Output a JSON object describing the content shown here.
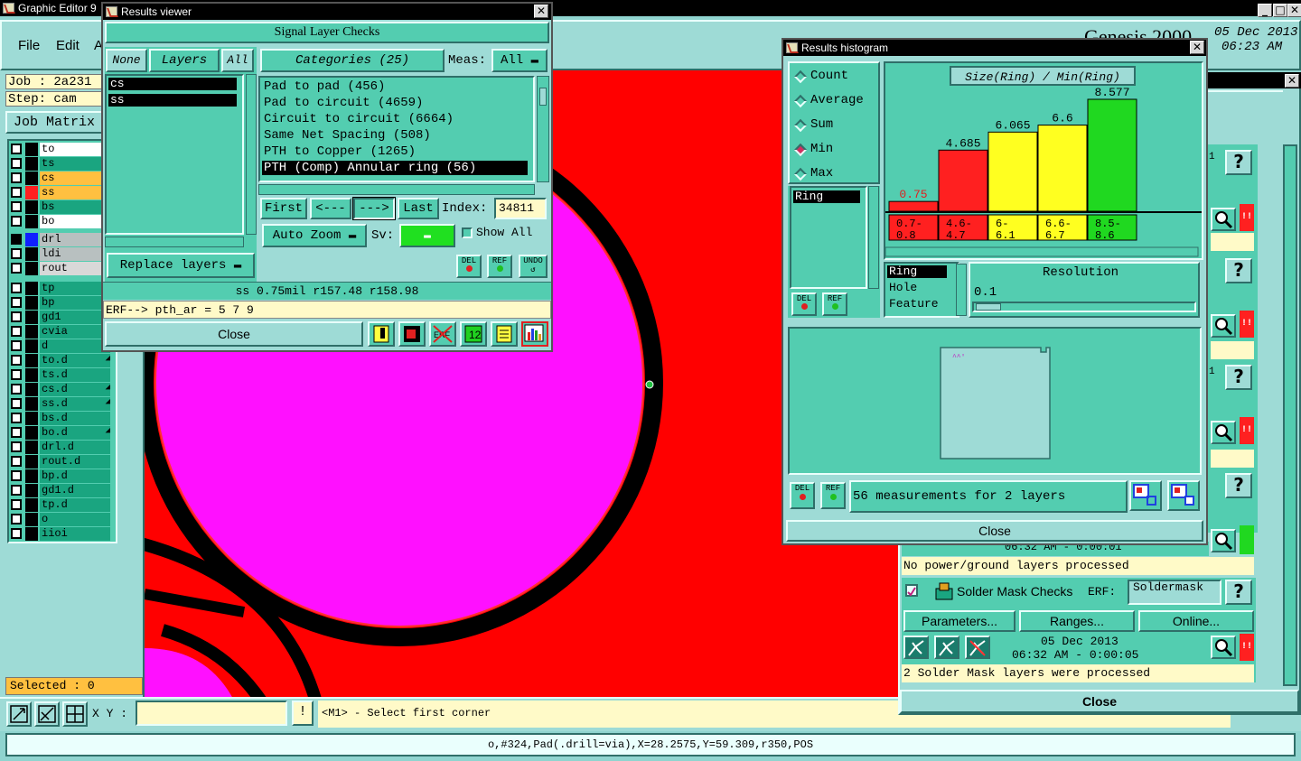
{
  "main_window": {
    "title": "Graphic Editor 9",
    "menu": [
      "File",
      "Edit",
      "A"
    ],
    "job": "Job : 2a231",
    "step": "Step: cam",
    "job_matrix": "Job Matrix",
    "selected": "Selected : 0",
    "xy_label": "X Y :",
    "xy_value": "",
    "prompt": "<M1> - Select first corner",
    "status": "o,#324,Pad(.drill=via),X=28.2575,Y=59.309,r350,POS",
    "genesis": "Genesis 2000",
    "date": "05 Dec 2013",
    "time": "06:23 AM"
  },
  "layers": [
    {
      "name": "to",
      "color": "#ffffff",
      "swatch": "#000000"
    },
    {
      "name": "ts",
      "color": "#1aa580",
      "swatch": "#000000"
    },
    {
      "name": "cs",
      "color": "#ffc040",
      "swatch": "#000000"
    },
    {
      "name": "ss",
      "color": "#ffc040",
      "swatch": "#ff2020"
    },
    {
      "name": "bs",
      "color": "#1aa580",
      "swatch": "#000000"
    },
    {
      "name": "bo",
      "color": "#ffffff",
      "swatch": "#000000"
    },
    {
      "name": "drl",
      "color": "#b8c0c0",
      "swatch": "#1020ff"
    },
    {
      "name": "ldi",
      "color": "#b8c0c0",
      "swatch": "#000000"
    },
    {
      "name": "rout",
      "color": "#d8d8d8",
      "swatch": "#000000"
    },
    {
      "name": "tp",
      "color": "#1aa580",
      "swatch": "#000000"
    },
    {
      "name": "bp",
      "color": "#1aa580",
      "swatch": "#000000"
    },
    {
      "name": "gd1",
      "color": "#1aa580",
      "swatch": "#000000"
    },
    {
      "name": "cvia",
      "color": "#1aa580",
      "swatch": "#000000"
    },
    {
      "name": "d",
      "color": "#1aa580",
      "swatch": "#000000"
    },
    {
      "name": "to.d",
      "color": "#1aa580",
      "swatch": "#000000",
      "mark": true
    },
    {
      "name": "ts.d",
      "color": "#1aa580",
      "swatch": "#000000"
    },
    {
      "name": "cs.d",
      "color": "#1aa580",
      "swatch": "#000000",
      "mark": true
    },
    {
      "name": "ss.d",
      "color": "#1aa580",
      "swatch": "#000000",
      "mark": true
    },
    {
      "name": "bs.d",
      "color": "#1aa580",
      "swatch": "#000000"
    },
    {
      "name": "bo.d",
      "color": "#1aa580",
      "swatch": "#000000",
      "mark": true
    },
    {
      "name": "drl.d",
      "color": "#1aa580",
      "swatch": "#000000"
    },
    {
      "name": "rout.d",
      "color": "#1aa580",
      "swatch": "#000000"
    },
    {
      "name": "bp.d",
      "color": "#1aa580",
      "swatch": "#000000"
    },
    {
      "name": "gd1.d",
      "color": "#1aa580",
      "swatch": "#000000"
    },
    {
      "name": "tp.d",
      "color": "#1aa580",
      "swatch": "#000000"
    },
    {
      "name": "o",
      "color": "#1aa580",
      "swatch": "#000000"
    },
    {
      "name": "iioi",
      "color": "#1aa580",
      "swatch": "#000000"
    }
  ],
  "results_viewer": {
    "title": "Results viewer",
    "header": "Signal Layer Checks",
    "none": "None",
    "layers_label": "Layers",
    "all": "All",
    "layer_list": [
      "cs",
      "ss"
    ],
    "categories_label": "Categories (25)",
    "meas_label": "Meas:",
    "meas_value": "All",
    "categories": [
      "Pad to pad (456)",
      "Pad to circuit (4659)",
      "Circuit to circuit (6664)",
      "Same Net Spacing (508)",
      "PTH to Copper (1265)",
      "PTH (Comp) Annular ring (56)"
    ],
    "first": "First",
    "prev": "<---",
    "next": "--->",
    "last": "Last",
    "index_label": "Index:",
    "index_value": "34811",
    "auto_zoom": "Auto Zoom",
    "sv_label": "Sv:",
    "show_all": "Show All",
    "replace_layers": "Replace layers",
    "del": "DEL",
    "ref": "REF",
    "undo": "UNDO",
    "info_line": "ss 0.75mil  r157.48  r158.98",
    "erf_line": "ERF--> pth_ar = 5 7 9",
    "close": "Close"
  },
  "histogram": {
    "title": "Results histogram",
    "options": [
      "Count",
      "Average",
      "Sum",
      "Min",
      "Max"
    ],
    "selected_option": "Min",
    "chart_title": "Size(Ring) / Min(Ring)",
    "list": [
      "Ring"
    ],
    "types": [
      "Ring",
      "Hole",
      "Feature"
    ],
    "resolution_label": "Resolution",
    "resolution_value": "0.1",
    "summary": "56 measurements for 2 layers",
    "close": "Close",
    "del": "DEL",
    "ref": "REF",
    "mini_label": "^^'"
  },
  "chart_data": {
    "type": "bar",
    "title": "Size(Ring) / Min(Ring)",
    "categories": [
      "0.7-0.8",
      "4.6-4.7",
      "6-6.1",
      "6.6-6.7",
      "8.5-8.6"
    ],
    "category_lines": [
      [
        "0.7-",
        "0.8"
      ],
      [
        "4.6-",
        "4.7"
      ],
      [
        "6-",
        "6.1"
      ],
      [
        "6.6-",
        "6.7"
      ],
      [
        "8.5-",
        "8.6"
      ]
    ],
    "values": [
      0.75,
      4.685,
      6.065,
      6.6,
      8.577
    ],
    "value_labels": [
      "0.75",
      "4.685",
      "6.065",
      "6.6",
      "8.577"
    ],
    "colors": [
      "#ff2020",
      "#ff2020",
      "#ffff20",
      "#ffff20",
      "#20d820"
    ],
    "ylim": [
      0,
      8.577
    ]
  },
  "checklist": {
    "no_power": "No power/ground layers processed",
    "solder_title": "Solder Mask Checks",
    "erf_label": "ERF:",
    "erf_value": "Soldermask",
    "parameters": "Parameters...",
    "ranges": "Ranges...",
    "online": "Online...",
    "date": "05 Dec 2013",
    "time_line": "06:32 AM - 0:00:05",
    "partial_time": "06:32 AM - 0:00:01",
    "processed": "2 Solder Mask layers were processed",
    "close": "Close",
    "help": "?",
    "one": "1",
    "bang": "!!"
  }
}
